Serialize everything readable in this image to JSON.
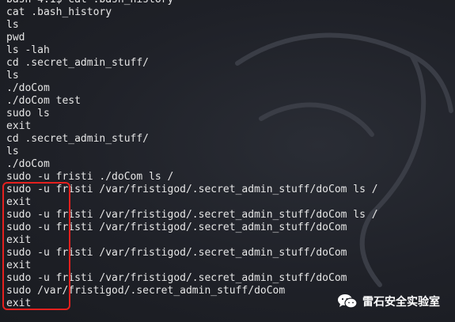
{
  "terminal": {
    "lines": [
      "bash-4.1$ cat .bash_history",
      "cat .bash_history",
      "ls",
      "pwd",
      "ls -lah",
      "cd .secret_admin_stuff/",
      "ls",
      "./doCom",
      "./doCom test",
      "sudo ls",
      "exit",
      "cd .secret_admin_stuff/",
      "ls",
      "./doCom",
      "sudo -u fristi ./doCom ls /",
      "sudo -u fristi /var/fristigod/.secret_admin_stuff/doCom ls /",
      "exit",
      "sudo -u fristi /var/fristigod/.secret_admin_stuff/doCom ls /",
      "sudo -u fristi /var/fristigod/.secret_admin_stuff/doCom",
      "exit",
      "sudo -u fristi /var/fristigod/.secret_admin_stuff/doCom",
      "exit",
      "sudo -u fristi /var/fristigod/.secret_admin_stuff/doCom",
      "sudo /var/fristigod/.secret_admin_stuff/doCom",
      "exit"
    ]
  },
  "watermark": {
    "text": "雷石安全实验室",
    "icon": "wechat-icon"
  },
  "colors": {
    "background": "#1c1e24",
    "text": "#e6e6e6",
    "highlight": "#e4201e"
  }
}
